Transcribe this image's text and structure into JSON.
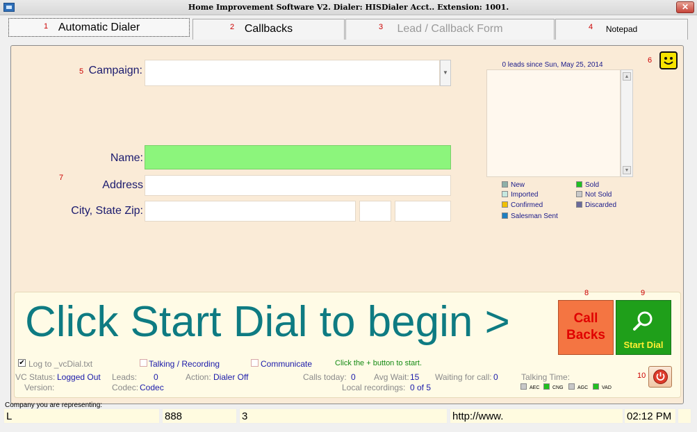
{
  "window": {
    "title": "Home Improvement Software V2. Dialer: HISDialer Acct.. Extension: 1001.",
    "close_glyph": "✕"
  },
  "tabs": [
    {
      "num": "1",
      "label": "Automatic Dialer"
    },
    {
      "num": "2",
      "label": "Callbacks"
    },
    {
      "num": "3",
      "label": "Lead / Callback Form"
    },
    {
      "num": "4",
      "label": "Notepad"
    }
  ],
  "markers": {
    "m5": "5",
    "m6": "6",
    "m7": "7",
    "m8": "8",
    "m9": "9",
    "m10": "10"
  },
  "form": {
    "campaign_label": "Campaign:",
    "campaign_value": "",
    "name_label": "Name:",
    "name_value": "",
    "address_label": "Address",
    "address_value": "",
    "city_label": "City, State Zip:",
    "city_value": "",
    "state_value": "",
    "zip_value": ""
  },
  "leads": {
    "caption": "0 leads since Sun, May 25, 2014",
    "legend": [
      {
        "label": "New",
        "color": "#8fb0a8"
      },
      {
        "label": "Imported",
        "color": "#c6e8e0"
      },
      {
        "label": "Confirmed",
        "color": "#f0c000"
      },
      {
        "label": "Salesman Sent",
        "color": "#1f7fc0"
      },
      {
        "label": "Sold",
        "color": "#20c020"
      },
      {
        "label": "Not Sold",
        "color": "#c8c8c8"
      },
      {
        "label": "Discarded",
        "color": "#6a6a9a"
      }
    ]
  },
  "dialer": {
    "message": "Click Start Dial to begin >",
    "callbacks_button_line1": "Call",
    "callbacks_button_line2": "Backs",
    "start_dial_label": "Start Dial"
  },
  "status": {
    "log_label": "Log to _vcDial.txt",
    "log_checked": "✔",
    "talking_label": "Talking / Recording",
    "communicate_label": "Communicate",
    "hint": "Click the + button to start.",
    "vc_status_label": "VC Status:",
    "vc_status_value": "Logged Out",
    "leads_label": "Leads:",
    "leads_value": "0",
    "action_label": "Action:",
    "action_value": "Dialer Off",
    "calls_today_label": "Calls today:",
    "calls_today_value": "0",
    "avg_wait_label": "Avg Wait:",
    "avg_wait_value": "15",
    "waiting_label": "Waiting for call:",
    "waiting_value": "0",
    "talking_time_label": "Talking Time:",
    "version_label": "Version:",
    "codec_label": "Codec:",
    "codec_value": "Codec",
    "local_rec_label": "Local recordings:",
    "local_rec_value": "0 of 5",
    "indicators": [
      "AEC",
      "CNG",
      "AGC",
      "VAD"
    ]
  },
  "statusbar": {
    "company_label": "Company you are representing:",
    "cell1": "L",
    "cell2": "888",
    "cell3": "3",
    "cell4": "http://www.",
    "cell5": "02:12 PM"
  }
}
